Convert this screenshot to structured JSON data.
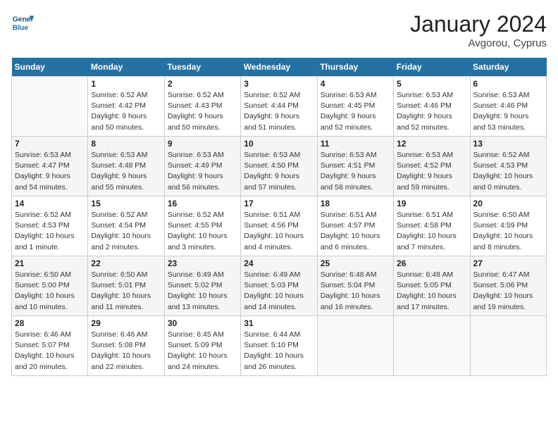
{
  "header": {
    "logo_line1": "General",
    "logo_line2": "Blue",
    "month_title": "January 2024",
    "location": "Avgorou, Cyprus"
  },
  "weekdays": [
    "Sunday",
    "Monday",
    "Tuesday",
    "Wednesday",
    "Thursday",
    "Friday",
    "Saturday"
  ],
  "weeks": [
    [
      {
        "day": "",
        "info": ""
      },
      {
        "day": "1",
        "info": "Sunrise: 6:52 AM\nSunset: 4:42 PM\nDaylight: 9 hours\nand 50 minutes."
      },
      {
        "day": "2",
        "info": "Sunrise: 6:52 AM\nSunset: 4:43 PM\nDaylight: 9 hours\nand 50 minutes."
      },
      {
        "day": "3",
        "info": "Sunrise: 6:52 AM\nSunset: 4:44 PM\nDaylight: 9 hours\nand 51 minutes."
      },
      {
        "day": "4",
        "info": "Sunrise: 6:53 AM\nSunset: 4:45 PM\nDaylight: 9 hours\nand 52 minutes."
      },
      {
        "day": "5",
        "info": "Sunrise: 6:53 AM\nSunset: 4:46 PM\nDaylight: 9 hours\nand 52 minutes."
      },
      {
        "day": "6",
        "info": "Sunrise: 6:53 AM\nSunset: 4:46 PM\nDaylight: 9 hours\nand 53 minutes."
      }
    ],
    [
      {
        "day": "7",
        "info": "Sunrise: 6:53 AM\nSunset: 4:47 PM\nDaylight: 9 hours\nand 54 minutes."
      },
      {
        "day": "8",
        "info": "Sunrise: 6:53 AM\nSunset: 4:48 PM\nDaylight: 9 hours\nand 55 minutes."
      },
      {
        "day": "9",
        "info": "Sunrise: 6:53 AM\nSunset: 4:49 PM\nDaylight: 9 hours\nand 56 minutes."
      },
      {
        "day": "10",
        "info": "Sunrise: 6:53 AM\nSunset: 4:50 PM\nDaylight: 9 hours\nand 57 minutes."
      },
      {
        "day": "11",
        "info": "Sunrise: 6:53 AM\nSunset: 4:51 PM\nDaylight: 9 hours\nand 58 minutes."
      },
      {
        "day": "12",
        "info": "Sunrise: 6:53 AM\nSunset: 4:52 PM\nDaylight: 9 hours\nand 59 minutes."
      },
      {
        "day": "13",
        "info": "Sunrise: 6:52 AM\nSunset: 4:53 PM\nDaylight: 10 hours\nand 0 minutes."
      }
    ],
    [
      {
        "day": "14",
        "info": "Sunrise: 6:52 AM\nSunset: 4:53 PM\nDaylight: 10 hours\nand 1 minute."
      },
      {
        "day": "15",
        "info": "Sunrise: 6:52 AM\nSunset: 4:54 PM\nDaylight: 10 hours\nand 2 minutes."
      },
      {
        "day": "16",
        "info": "Sunrise: 6:52 AM\nSunset: 4:55 PM\nDaylight: 10 hours\nand 3 minutes."
      },
      {
        "day": "17",
        "info": "Sunrise: 6:51 AM\nSunset: 4:56 PM\nDaylight: 10 hours\nand 4 minutes."
      },
      {
        "day": "18",
        "info": "Sunrise: 6:51 AM\nSunset: 4:57 PM\nDaylight: 10 hours\nand 6 minutes."
      },
      {
        "day": "19",
        "info": "Sunrise: 6:51 AM\nSunset: 4:58 PM\nDaylight: 10 hours\nand 7 minutes."
      },
      {
        "day": "20",
        "info": "Sunrise: 6:50 AM\nSunset: 4:59 PM\nDaylight: 10 hours\nand 8 minutes."
      }
    ],
    [
      {
        "day": "21",
        "info": "Sunrise: 6:50 AM\nSunset: 5:00 PM\nDaylight: 10 hours\nand 10 minutes."
      },
      {
        "day": "22",
        "info": "Sunrise: 6:50 AM\nSunset: 5:01 PM\nDaylight: 10 hours\nand 11 minutes."
      },
      {
        "day": "23",
        "info": "Sunrise: 6:49 AM\nSunset: 5:02 PM\nDaylight: 10 hours\nand 13 minutes."
      },
      {
        "day": "24",
        "info": "Sunrise: 6:49 AM\nSunset: 5:03 PM\nDaylight: 10 hours\nand 14 minutes."
      },
      {
        "day": "25",
        "info": "Sunrise: 6:48 AM\nSunset: 5:04 PM\nDaylight: 10 hours\nand 16 minutes."
      },
      {
        "day": "26",
        "info": "Sunrise: 6:48 AM\nSunset: 5:05 PM\nDaylight: 10 hours\nand 17 minutes."
      },
      {
        "day": "27",
        "info": "Sunrise: 6:47 AM\nSunset: 5:06 PM\nDaylight: 10 hours\nand 19 minutes."
      }
    ],
    [
      {
        "day": "28",
        "info": "Sunrise: 6:46 AM\nSunset: 5:07 PM\nDaylight: 10 hours\nand 20 minutes."
      },
      {
        "day": "29",
        "info": "Sunrise: 6:46 AM\nSunset: 5:08 PM\nDaylight: 10 hours\nand 22 minutes."
      },
      {
        "day": "30",
        "info": "Sunrise: 6:45 AM\nSunset: 5:09 PM\nDaylight: 10 hours\nand 24 minutes."
      },
      {
        "day": "31",
        "info": "Sunrise: 6:44 AM\nSunset: 5:10 PM\nDaylight: 10 hours\nand 26 minutes."
      },
      {
        "day": "",
        "info": ""
      },
      {
        "day": "",
        "info": ""
      },
      {
        "day": "",
        "info": ""
      }
    ]
  ]
}
